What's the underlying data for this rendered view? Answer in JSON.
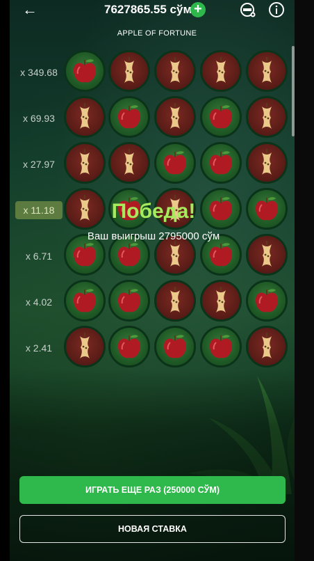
{
  "header": {
    "balance": "7627865.55 сўм",
    "game_title": "APPLE OF FORTUNE",
    "icons": [
      "back-arrow-icon",
      "add-funds-icon",
      "settings-icon",
      "info-icon"
    ]
  },
  "multipliers": [
    "x 349.68",
    "x 69.93",
    "x 27.97",
    "x 11.18",
    "x 6.71",
    "x 4.02",
    "x 2.41"
  ],
  "active_multiplier": "x 11.18",
  "grid": [
    [
      "apple",
      "core",
      "core",
      "core",
      "core"
    ],
    [
      "core",
      "apple",
      "core",
      "apple",
      "core"
    ],
    [
      "core",
      "core",
      "apple",
      "apple",
      "core"
    ],
    [
      "core",
      "apple",
      "core",
      "apple",
      "apple"
    ],
    [
      "apple",
      "apple",
      "core",
      "apple",
      "core"
    ],
    [
      "apple",
      "apple",
      "core",
      "core",
      "apple"
    ],
    [
      "core",
      "apple",
      "apple",
      "apple",
      "core"
    ]
  ],
  "result": {
    "title": "Победа!",
    "message": "Ваш выигрыш 2795000 сўм"
  },
  "buttons": {
    "play_again": "ИГРАТЬ ЕЩЕ РАЗ (250000 СЎМ)",
    "new_bet": "НОВАЯ СТАВКА"
  },
  "colors": {
    "accent_green": "#2fb84b",
    "win_text": "#a6ea5e"
  }
}
